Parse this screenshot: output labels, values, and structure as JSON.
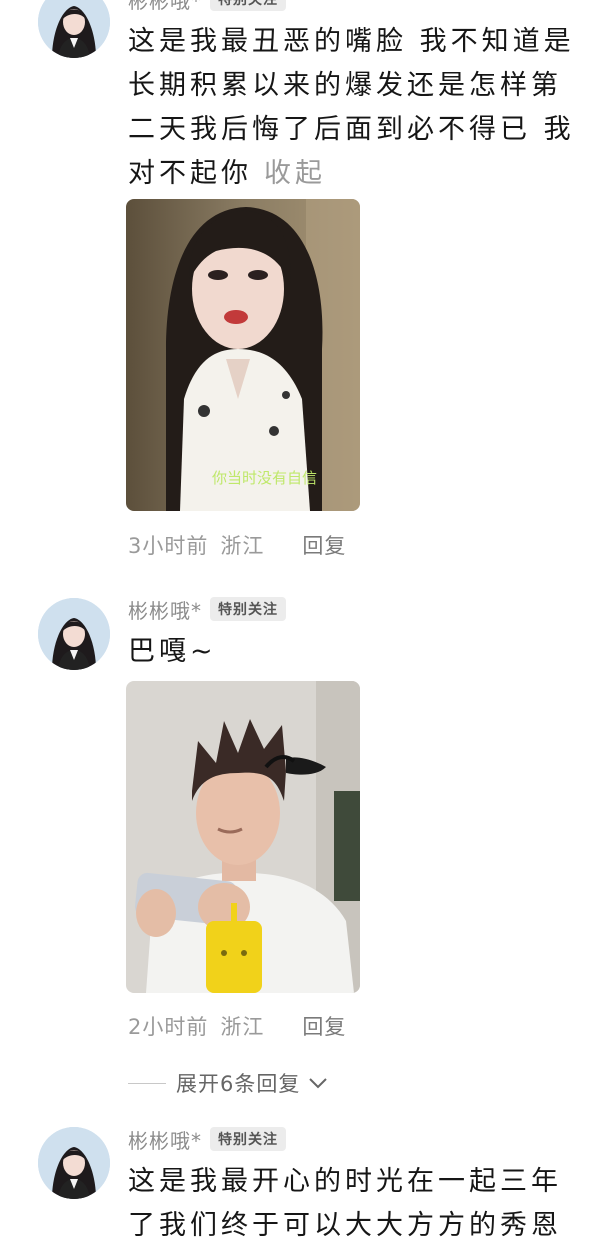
{
  "comments": [
    {
      "username": "彬彬哦*",
      "badge": "特别关注",
      "text": "这是我最丑恶的嘴脸 我不知道是长期积累以来的爆发还是怎样第二天我后悔了后面到必不得已 我对不起你",
      "collapse": "收起",
      "photo_caption": "你当时没有自信",
      "time": "3小时前",
      "location": "浙江",
      "reply": "回复"
    },
    {
      "username": "彬彬哦*",
      "badge": "特别关注",
      "text": "巴嘎~",
      "time": "2小时前",
      "location": "浙江",
      "reply": "回复"
    },
    {
      "username": "彬彬哦*",
      "badge": "特别关注",
      "text": "这是我最开心的时光在一起三年了我们终于可以大大方方的秀恩爱了"
    }
  ],
  "expand_replies": "展开6条回复",
  "icons": {
    "expand": "chevron-down-icon"
  }
}
